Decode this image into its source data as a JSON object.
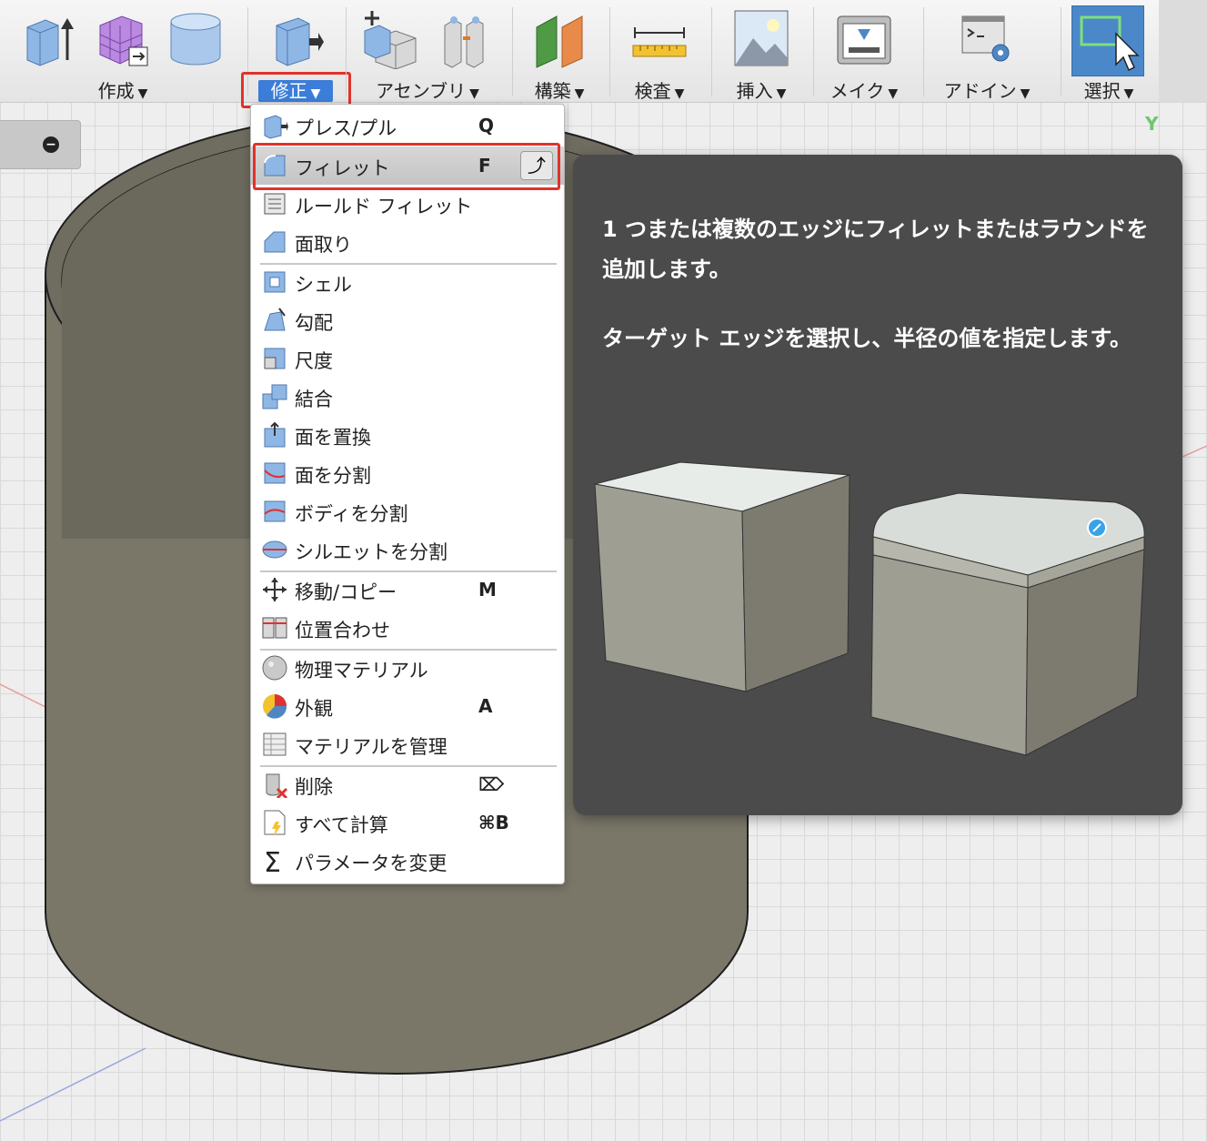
{
  "toolbar": {
    "groups": [
      {
        "label": "作成",
        "icons": [
          "extrude-box-icon",
          "form-cube-icon",
          "cylinder-icon"
        ]
      },
      {
        "label": "修正",
        "icons": [
          "press-pull-icon"
        ]
      },
      {
        "label": "アセンブリ",
        "icons": [
          "new-component-icon",
          "joint-icon"
        ]
      },
      {
        "label": "構築",
        "icons": [
          "offset-plane-icon"
        ]
      },
      {
        "label": "検査",
        "icons": [
          "measure-icon"
        ]
      },
      {
        "label": "挿入",
        "icons": [
          "insert-image-icon"
        ]
      },
      {
        "label": "メイク",
        "icons": [
          "3d-print-icon"
        ]
      },
      {
        "label": "アドイン",
        "icons": [
          "scripts-addins-icon"
        ]
      },
      {
        "label": "選択",
        "icons": [
          "select-cursor-icon"
        ]
      }
    ],
    "dropdown_arrow": "▼",
    "active_group": "修正"
  },
  "menu": {
    "items": [
      {
        "label": "プレス/プル",
        "shortcut": "Q",
        "icon": "press-pull-icon"
      },
      {
        "label": "フィレット",
        "shortcut": "F",
        "icon": "fillet-icon",
        "highlighted": true,
        "repeat_icon": "repeat-command-icon"
      },
      {
        "label": "ルールド フィレット",
        "shortcut": "",
        "icon": "rule-fillet-icon"
      },
      {
        "label": "面取り",
        "shortcut": "",
        "icon": "chamfer-icon"
      },
      {
        "label": "シェル",
        "shortcut": "",
        "icon": "shell-icon"
      },
      {
        "label": "勾配",
        "shortcut": "",
        "icon": "draft-icon"
      },
      {
        "label": "尺度",
        "shortcut": "",
        "icon": "scale-icon"
      },
      {
        "label": "結合",
        "shortcut": "",
        "icon": "combine-icon"
      },
      {
        "label": "面を置換",
        "shortcut": "",
        "icon": "replace-face-icon"
      },
      {
        "label": "面を分割",
        "shortcut": "",
        "icon": "split-face-icon"
      },
      {
        "label": "ボディを分割",
        "shortcut": "",
        "icon": "split-body-icon"
      },
      {
        "label": "シルエットを分割",
        "shortcut": "",
        "icon": "silhouette-split-icon"
      },
      {
        "label": "移動/コピー",
        "shortcut": "M",
        "icon": "move-icon"
      },
      {
        "label": "位置合わせ",
        "shortcut": "",
        "icon": "align-icon"
      },
      {
        "label": "物理マテリアル",
        "shortcut": "",
        "icon": "physical-material-icon"
      },
      {
        "label": "外観",
        "shortcut": "A",
        "icon": "appearance-icon"
      },
      {
        "label": "マテリアルを管理",
        "shortcut": "",
        "icon": "manage-materials-icon"
      },
      {
        "label": "削除",
        "shortcut": "⌦",
        "icon": "delete-icon"
      },
      {
        "label": "すべて計算",
        "shortcut": "⌘B",
        "icon": "compute-all-icon"
      },
      {
        "label": "パラメータを変更",
        "shortcut": "",
        "icon": "sigma-icon"
      }
    ]
  },
  "tooltip": {
    "line1": "1 つまたは複数のエッジにフィレットまたはラウンドを追加します。",
    "line2": "ターゲット エッジを選択し、半径の値を指定します。"
  },
  "viewport": {
    "axis_label": "Y",
    "body_color": "#7a7769"
  },
  "colors": {
    "accent": "#3b7dd8",
    "highlight_border": "#e0322b",
    "tooltip_bg": "#4b4b4b"
  }
}
